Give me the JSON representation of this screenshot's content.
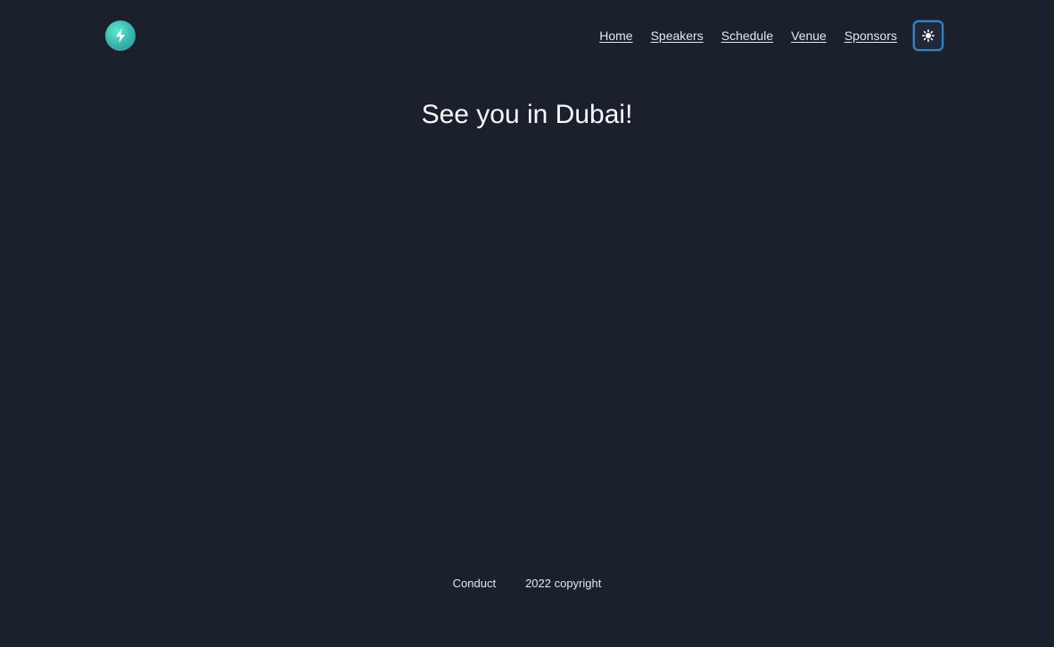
{
  "header": {
    "logo_icon": "lightning-bolt-icon",
    "nav": {
      "home": "Home",
      "speakers": "Speakers",
      "schedule": "Schedule",
      "venue": "Venue",
      "sponsors": "Sponsors"
    },
    "theme_toggle_icon": "sun-icon"
  },
  "main": {
    "headline": "See you in Dubai!"
  },
  "footer": {
    "conduct": "Conduct",
    "copyright": "2022 copyright"
  },
  "colors": {
    "background": "#1a202c",
    "accent": "#38b2ac",
    "focus_ring": "#3182ce"
  }
}
